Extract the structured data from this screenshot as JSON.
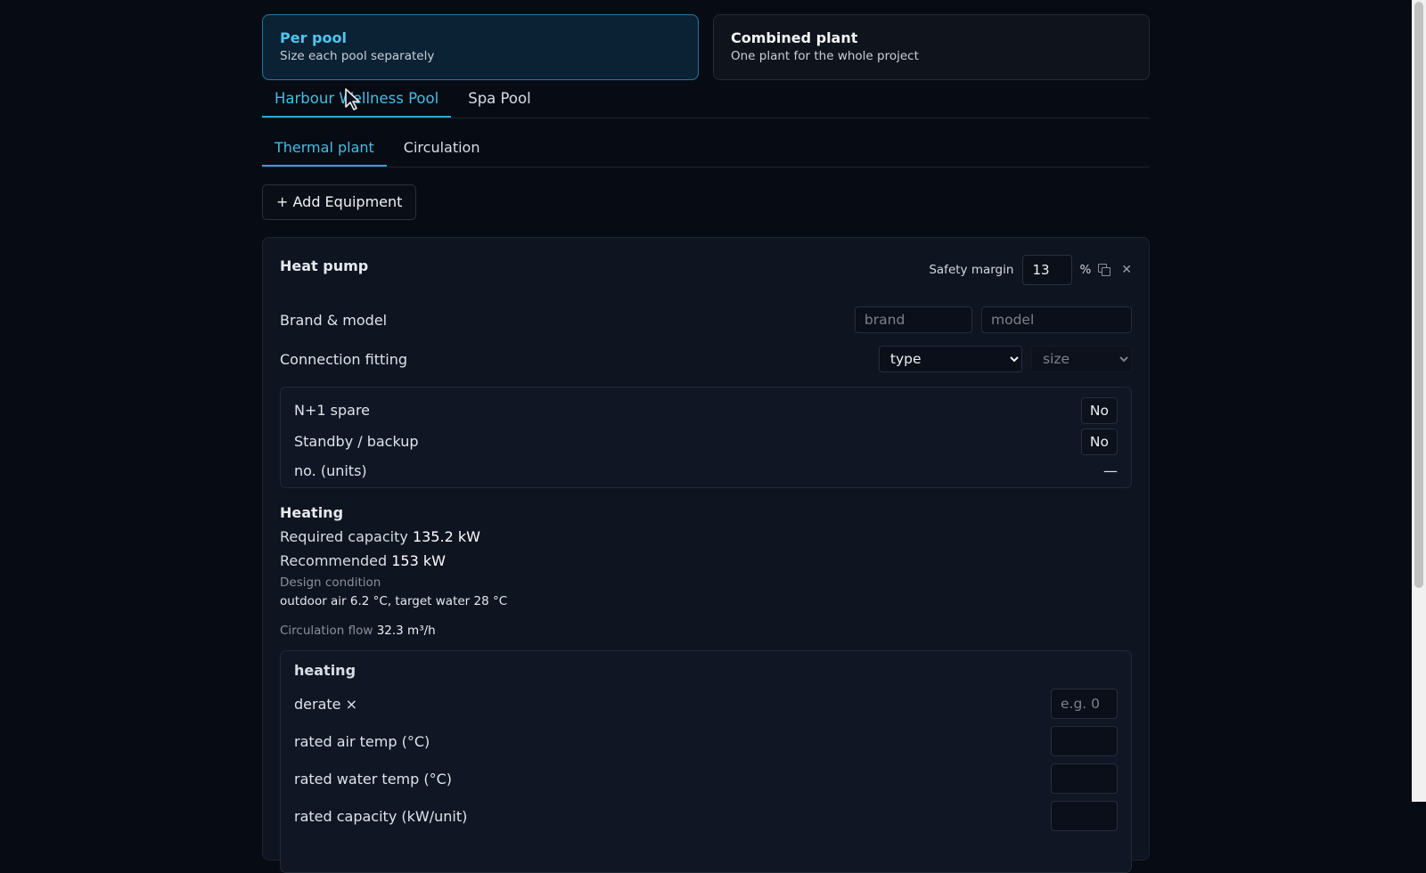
{
  "modes": [
    {
      "title": "Per pool",
      "subtitle": "Size each pool separately",
      "active": true
    },
    {
      "title": "Combined plant",
      "subtitle": "One plant for the whole project",
      "active": false
    }
  ],
  "pool_tabs": [
    {
      "label": "Harbour Wellness Pool",
      "active": true
    },
    {
      "label": "Spa Pool",
      "active": false
    }
  ],
  "section_tabs": [
    {
      "label": "Thermal plant",
      "active": true
    },
    {
      "label": "Circulation",
      "active": false
    }
  ],
  "add_equipment_label": "+ Add Equipment",
  "equipment": {
    "title": "Heat pump",
    "safety_margin_label": "Safety margin",
    "safety_margin_value": "13",
    "safety_margin_unit": "%",
    "brand_model_label": "Brand & model",
    "brand_placeholder": "brand",
    "model_placeholder": "model",
    "connection_label": "Connection fitting",
    "type_selected": "type",
    "size_selected": "size",
    "options": {
      "n1_spare_label": "N+1 spare",
      "n1_spare_value": "No",
      "standby_label": "Standby / backup",
      "standby_value": "No",
      "units_label": "no. (units)",
      "units_value": "—"
    },
    "heating": {
      "title": "Heating",
      "required_label": "Required capacity",
      "required_value": "135.2 kW",
      "recommended_label": "Recommended",
      "recommended_value": "153 kW",
      "design_label": "Design condition",
      "design_value": "outdoor air 6.2 °C, target water 28 °C",
      "flow_label": "Circulation flow",
      "flow_value": "32.3 m³/h"
    },
    "sub": {
      "title": "heating",
      "derate_label": "derate ×",
      "derate_placeholder": "e.g. 0",
      "rated_air_label": "rated air temp (°C)",
      "rated_water_label": "rated water temp (°C)",
      "rated_capacity_label": "rated capacity (kW/unit)"
    }
  },
  "colors": {
    "background": "#070b14",
    "accent": "#44bde3",
    "active_card": "#0b2234"
  }
}
